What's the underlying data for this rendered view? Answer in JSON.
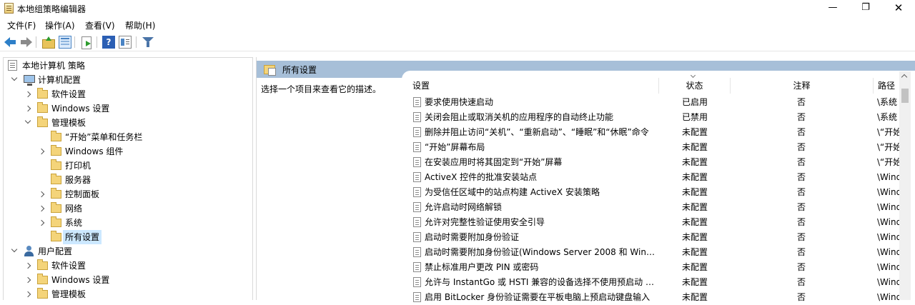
{
  "window": {
    "title": "本地组策略编辑器",
    "minimize_glyph": "—",
    "maximize_glyph": "❐",
    "close_glyph": "✕"
  },
  "menu": [
    "文件(F)",
    "操作(A)",
    "查看(V)",
    "帮助(H)"
  ],
  "toolbar": {
    "help_glyph": "?",
    "icons": [
      "back-arrow-icon",
      "forward-arrow-icon",
      "up-folder-icon",
      "show-tree-icon",
      "export-list-icon",
      "help-icon",
      "properties-icon",
      "filter-icon"
    ]
  },
  "tree": {
    "root": "本地计算机 策略",
    "computer_config": "计算机配置",
    "cc_software": "软件设置",
    "cc_windows": "Windows 设置",
    "cc_admin": "管理模板",
    "at_start": "“开始”菜单和任务栏",
    "at_wincomp": "Windows 组件",
    "at_printer": "打印机",
    "at_server": "服务器",
    "at_control": "控制面板",
    "at_network": "网络",
    "at_system": "系统",
    "at_all": "所有设置",
    "user_config": "用户配置",
    "uc_software": "软件设置",
    "uc_windows": "Windows 设置",
    "uc_admin": "管理模板"
  },
  "right": {
    "header": "所有设置",
    "description": "选择一个项目来查看它的描述。",
    "columns": {
      "setting": "设置",
      "state": "状态",
      "comment": "注释",
      "path": "路径"
    },
    "rows": [
      {
        "name": "要求使用快速启动",
        "state": "已启用",
        "comment": "否",
        "path": "\\系统"
      },
      {
        "name": "关闭会阻止或取消关机的应用程序的自动终止功能",
        "state": "已禁用",
        "comment": "否",
        "path": "\\系统"
      },
      {
        "name": "删除并阻止访问“关机”、“重新启动”、“睡眠”和“休眠”命令",
        "state": "未配置",
        "comment": "否",
        "path": "\\“开始"
      },
      {
        "name": "“开始”屏幕布局",
        "state": "未配置",
        "comment": "否",
        "path": "\\“开始"
      },
      {
        "name": "在安装应用时将其固定到“开始”屏幕",
        "state": "未配置",
        "comment": "否",
        "path": "\\“开始"
      },
      {
        "name": "ActiveX 控件的批准安装站点",
        "state": "未配置",
        "comment": "否",
        "path": "\\Wind"
      },
      {
        "name": "为受信任区域中的站点构建 ActiveX 安装策略",
        "state": "未配置",
        "comment": "否",
        "path": "\\Wind"
      },
      {
        "name": "允许启动时网络解锁",
        "state": "未配置",
        "comment": "否",
        "path": "\\Wind"
      },
      {
        "name": "允许对完整性验证使用安全引导",
        "state": "未配置",
        "comment": "否",
        "path": "\\Wind"
      },
      {
        "name": "启动时需要附加身份验证",
        "state": "未配置",
        "comment": "否",
        "path": "\\Wind"
      },
      {
        "name": "启动时需要附加身份验证(Windows Server 2008 和 Wind...",
        "state": "未配置",
        "comment": "否",
        "path": "\\Wind"
      },
      {
        "name": "禁止标准用户更改 PIN 或密码",
        "state": "未配置",
        "comment": "否",
        "path": "\\Wind"
      },
      {
        "name": "允许与 InstantGo 或 HSTI 兼容的设备选择不使用预启动 P...",
        "state": "未配置",
        "comment": "否",
        "path": "\\Wind"
      },
      {
        "name": "启用 BitLocker 身份验证需要在平板电脑上预启动键盘输入",
        "state": "未配置",
        "comment": "否",
        "path": "\\Wind"
      }
    ]
  }
}
